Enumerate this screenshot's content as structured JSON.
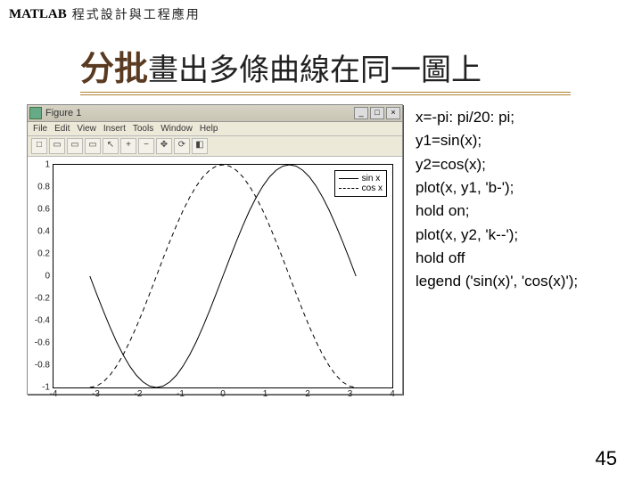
{
  "topbar": {
    "matlab": "MATLAB",
    "subtitle": "程式設計與工程應用"
  },
  "headline": {
    "accent": "分批",
    "rest": "畫出多條曲線在同一圖上"
  },
  "fig": {
    "title": "Figure 1",
    "menu": [
      "File",
      "Edit",
      "View",
      "Insert",
      "Tools",
      "Window",
      "Help"
    ],
    "sysbtn": {
      "min": "_",
      "max": "□",
      "close": "×"
    },
    "tool_filenew": "□",
    "tool_fileopen": "▭",
    "tool_save": "▭",
    "tool_print": "▭",
    "tool_arrow": "↖",
    "tool_zoomin": "+",
    "tool_zoomout": "−",
    "tool_pan": "✥",
    "tool_rotate": "⟳",
    "tool_data": "◧"
  },
  "legend": {
    "entry1": "sin x",
    "entry2": "cos x"
  },
  "axis": {
    "yticks": [
      "1",
      "0.8",
      "0.6",
      "0.4",
      "0.2",
      "0",
      "-0.2",
      "-0.4",
      "-0.6",
      "-0.8",
      "-1"
    ],
    "xticks": [
      "-4",
      "-3",
      "-2",
      "-1",
      "0",
      "1",
      "2",
      "3",
      "4"
    ]
  },
  "code": [
    "x=-pi: pi/20: pi;",
    "y1=sin(x);",
    "y2=cos(x);",
    "plot(x, y1, 'b-');",
    "hold on;",
    "plot(x, y2, 'k--');",
    "hold off",
    "legend ('sin(x)', 'cos(x)');"
  ],
  "page": "45",
  "chart_data": {
    "type": "line",
    "title": "",
    "xlabel": "",
    "ylabel": "",
    "xlim": [
      -4,
      4
    ],
    "ylim": [
      -1,
      1
    ],
    "x": [
      -3.1416,
      -2.9845,
      -2.8274,
      -2.6704,
      -2.5133,
      -2.3562,
      -2.1991,
      -2.042,
      -1.885,
      -1.7279,
      -1.5708,
      -1.4137,
      -1.2566,
      -1.0996,
      -0.9425,
      -0.7854,
      -0.6283,
      -0.4712,
      -0.3142,
      -0.1571,
      0,
      0.1571,
      0.3142,
      0.4712,
      0.6283,
      0.7854,
      0.9425,
      1.0996,
      1.2566,
      1.4137,
      1.5708,
      1.7279,
      1.885,
      2.042,
      2.1991,
      2.3562,
      2.5133,
      2.6704,
      2.8274,
      2.9845,
      3.1416
    ],
    "series": [
      {
        "name": "sin x",
        "style": "solid",
        "values": [
          0,
          -0.1564,
          -0.309,
          -0.454,
          -0.5878,
          -0.7071,
          -0.809,
          -0.891,
          -0.9511,
          -0.9877,
          -1.0,
          -0.9877,
          -0.9511,
          -0.891,
          -0.809,
          -0.7071,
          -0.5878,
          -0.454,
          -0.309,
          -0.1564,
          0,
          0.1564,
          0.309,
          0.454,
          0.5878,
          0.7071,
          0.809,
          0.891,
          0.9511,
          0.9877,
          1.0,
          0.9877,
          0.9511,
          0.891,
          0.809,
          0.7071,
          0.5878,
          0.454,
          0.309,
          0.1564,
          0
        ]
      },
      {
        "name": "cos x",
        "style": "dashed",
        "values": [
          -1.0,
          -0.9877,
          -0.9511,
          -0.891,
          -0.809,
          -0.7071,
          -0.5878,
          -0.454,
          -0.309,
          -0.1564,
          0,
          0.1564,
          0.309,
          0.454,
          0.5878,
          0.7071,
          0.809,
          0.891,
          0.9511,
          0.9877,
          1.0,
          0.9877,
          0.9511,
          0.891,
          0.809,
          0.7071,
          0.5878,
          0.454,
          0.309,
          0.1564,
          0,
          -0.1564,
          -0.309,
          -0.454,
          -0.5878,
          -0.7071,
          -0.809,
          -0.891,
          -0.9511,
          -0.9877,
          -1.0
        ]
      }
    ]
  }
}
